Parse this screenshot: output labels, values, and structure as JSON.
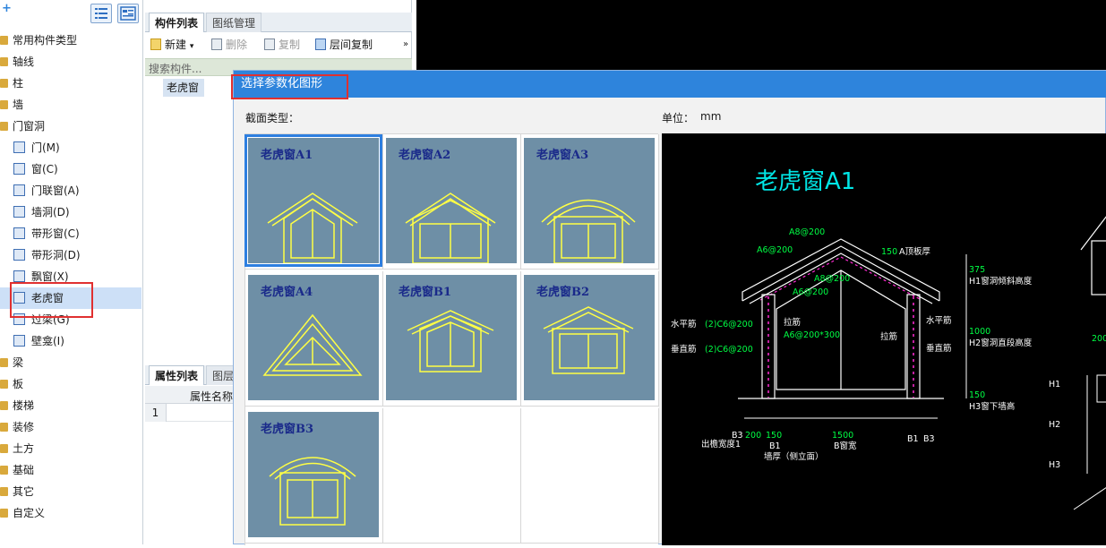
{
  "tree": {
    "top_glyph": "+",
    "items": [
      {
        "label": "常用构件类型",
        "kind": "folder",
        "icon": "folder-icon"
      },
      {
        "label": "轴线",
        "kind": "folder",
        "icon": "folder-icon"
      },
      {
        "label": "柱",
        "kind": "folder",
        "icon": "folder-icon"
      },
      {
        "label": "墙",
        "kind": "folder",
        "icon": "folder-icon"
      },
      {
        "label": "门窗洞",
        "kind": "folder",
        "icon": "folder-icon"
      },
      {
        "label": "门(M)",
        "kind": "child",
        "icon": "door-icon"
      },
      {
        "label": "窗(C)",
        "kind": "child",
        "icon": "window-icon"
      },
      {
        "label": "门联窗(A)",
        "kind": "child",
        "icon": "door-window-icon"
      },
      {
        "label": "墙洞(D)",
        "kind": "child",
        "icon": "wall-hole-icon"
      },
      {
        "label": "带形窗(C)",
        "kind": "child",
        "icon": "strip-window-icon"
      },
      {
        "label": "带形洞(D)",
        "kind": "child",
        "icon": "strip-hole-icon"
      },
      {
        "label": "飘窗(X)",
        "kind": "child",
        "icon": "bay-window-icon"
      },
      {
        "label": "老虎窗",
        "kind": "child",
        "icon": "dormer-window-icon",
        "selected": true
      },
      {
        "label": "过梁(G)",
        "kind": "child",
        "icon": "lintel-icon"
      },
      {
        "label": "壁龛(I)",
        "kind": "child",
        "icon": "niche-icon"
      },
      {
        "label": "梁",
        "kind": "folder",
        "icon": "folder-icon"
      },
      {
        "label": "板",
        "kind": "folder",
        "icon": "folder-icon"
      },
      {
        "label": "楼梯",
        "kind": "folder",
        "icon": "folder-icon"
      },
      {
        "label": "装修",
        "kind": "folder",
        "icon": "folder-icon"
      },
      {
        "label": "土方",
        "kind": "folder",
        "icon": "folder-icon"
      },
      {
        "label": "基础",
        "kind": "folder",
        "icon": "folder-icon"
      },
      {
        "label": "其它",
        "kind": "folder",
        "icon": "folder-icon"
      },
      {
        "label": "自定义",
        "kind": "folder",
        "icon": "folder-icon"
      }
    ]
  },
  "mid": {
    "tab_components": "构件列表",
    "tab_drawings": "图纸管理",
    "toolbar": {
      "new": "新建",
      "delete": "删除",
      "copy": "复制",
      "floor_copy": "层间复制",
      "more": "»"
    },
    "search_placeholder": "搜索构件...",
    "component": "老虎窗",
    "tab_props": "属性列表",
    "tab_layers": "图层",
    "prop_header": "属性名称",
    "row_num": "1"
  },
  "dialog": {
    "title": "选择参数化图形",
    "section_label": "截面类型：",
    "unit_label": "单位：",
    "unit_value": "mm",
    "thumbs": [
      "老虎窗A1",
      "老虎窗A2",
      "老虎窗A3",
      "老虎窗A4",
      "老虎窗B1",
      "老虎窗B2",
      "老虎窗B3"
    ],
    "preview": {
      "title": "老虎窗A1",
      "labels": {
        "a8": "A8@200",
        "a6l": "A6@200",
        "a6m": "A6@200",
        "a8m": "A8@200",
        "top_board": "A顶板厚",
        "v150": "150",
        "v375": "375",
        "h1": "H1窗洞倾斜高度",
        "hbar_l": "水平筋",
        "hbar_l_val": "(2)C6@200",
        "vbar_l": "垂直筋",
        "vbar_l_val": "(2)C6@200",
        "tie": "拉筋",
        "tie_val": "A6@200*300",
        "hbar_r": "水平筋",
        "tie_r": "拉筋",
        "vbar_r": "垂直筋",
        "v1000": "1000",
        "h2": "H2窗洞直段高度",
        "v150b": "150",
        "h3": "H3窗下墙高",
        "b3l": "B3",
        "d200": "200",
        "d150": "150",
        "d1500": "1500",
        "b1r": "B1",
        "b3r": "B3",
        "eave": "出檐宽度1",
        "b1l": "B1",
        "bwidth": "B窗宽",
        "wall": "墙厚（侧立面）",
        "rh1": "H1",
        "rh2": "H2",
        "rh3": "H3",
        "r200": "200"
      }
    }
  },
  "colors": {
    "accent": "#2e84dc",
    "highlight_box": "#e03030",
    "thumb_bg": "#6e8fa6",
    "cad_bg": "#000000",
    "cad_title": "#00e5e5",
    "cad_line": "#ffffff",
    "cad_rebar": "#ff2ad4",
    "cad_dim_text": "#00ff44"
  }
}
